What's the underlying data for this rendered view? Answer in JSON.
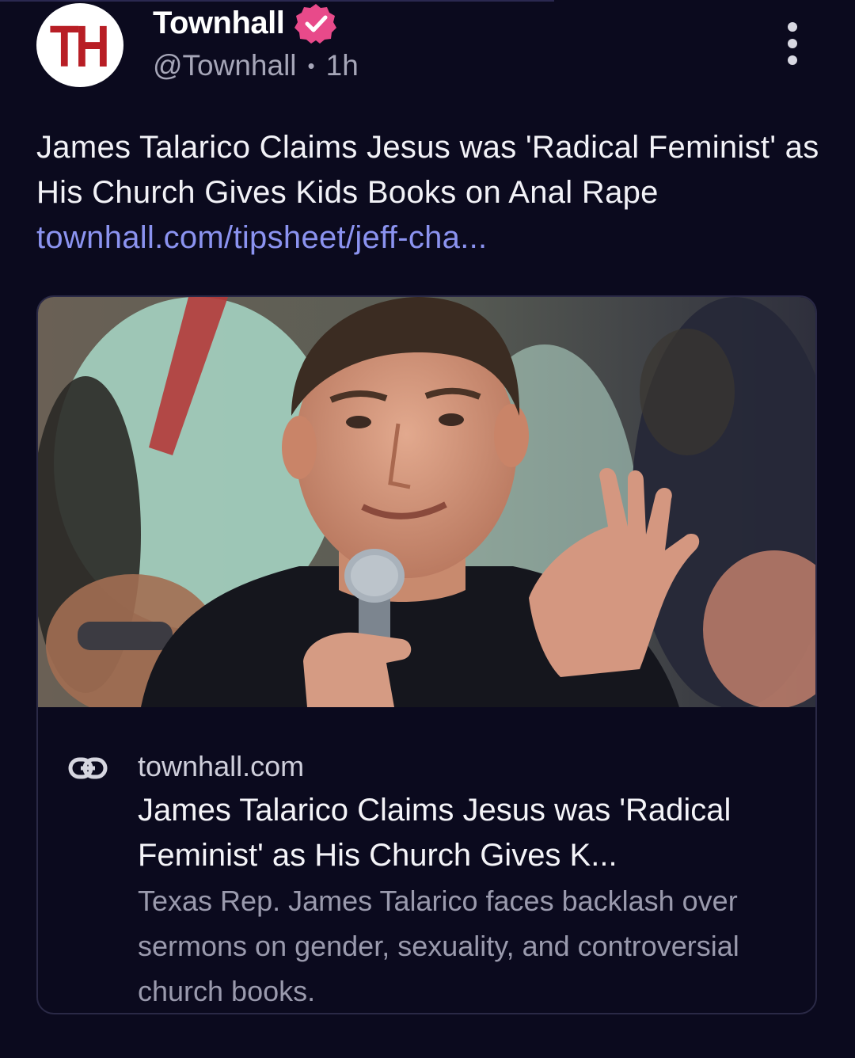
{
  "post": {
    "author": {
      "avatar_text": "TH",
      "display_name": "Townhall",
      "handle": "@Townhall",
      "separator": "•",
      "time": "1h"
    },
    "text": "James Talarico Claims Jesus was 'Radical Feminist' as His Church Gives Kids Books on Anal Rape",
    "link_text": "townhall.com/tipsheet/jeff-cha...",
    "card": {
      "domain": "townhall.com",
      "title": "James Talarico Claims Jesus was 'Radical Feminist' as His Church Gives K...",
      "description": "Texas Rep. James Talarico faces backlash over sermons on gender, sexuality, and controversial church books."
    }
  },
  "colors": {
    "background": "#0b0a1e",
    "link": "#8b93f0",
    "verified_badge": "#e84a8a",
    "avatar_letters": "#b81e25"
  },
  "icons": {
    "verified": "verified-badge-icon",
    "more": "more-options-icon",
    "link": "link-icon"
  }
}
